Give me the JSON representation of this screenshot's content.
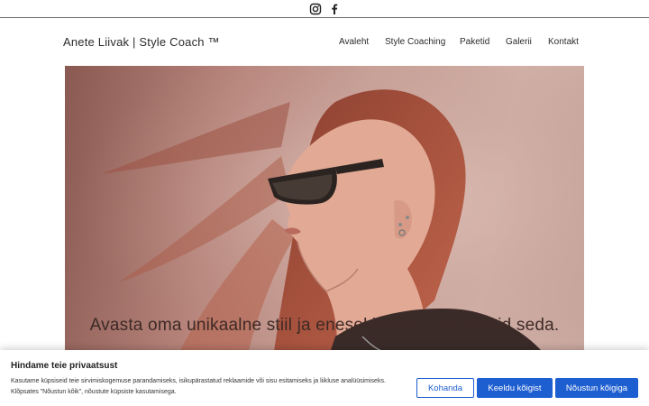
{
  "header": {
    "social": [
      {
        "icon": "instagram-icon"
      },
      {
        "icon": "facebook-icon"
      }
    ],
    "brand": "Anete Liivak | Style Coach ™",
    "nav": [
      "Avaleht",
      "Style Coaching",
      "Paketid",
      "Galerii",
      "Kontakt"
    ]
  },
  "hero": {
    "tagline": "Avasta oma unikaalne stiil ja enesekindlus – Sa väärid seda."
  },
  "cookie_banner": {
    "title": "Hindame teie privaatsust",
    "text": "Kasutame küpsiseid teie sirvimiskogemuse parandamiseks, isikupärastatud reklaamide või sisu esitamiseks ja liikluse analüüsimiseks. Klõpsates \"Nõustun kõik\", nõustute küpsiste kasutamisega.",
    "buttons": {
      "customize": "Kohanda",
      "reject": "Keeldu kõigist",
      "accept": "Nõustun kõigiga"
    },
    "accent_color": "#1d5ed1"
  }
}
